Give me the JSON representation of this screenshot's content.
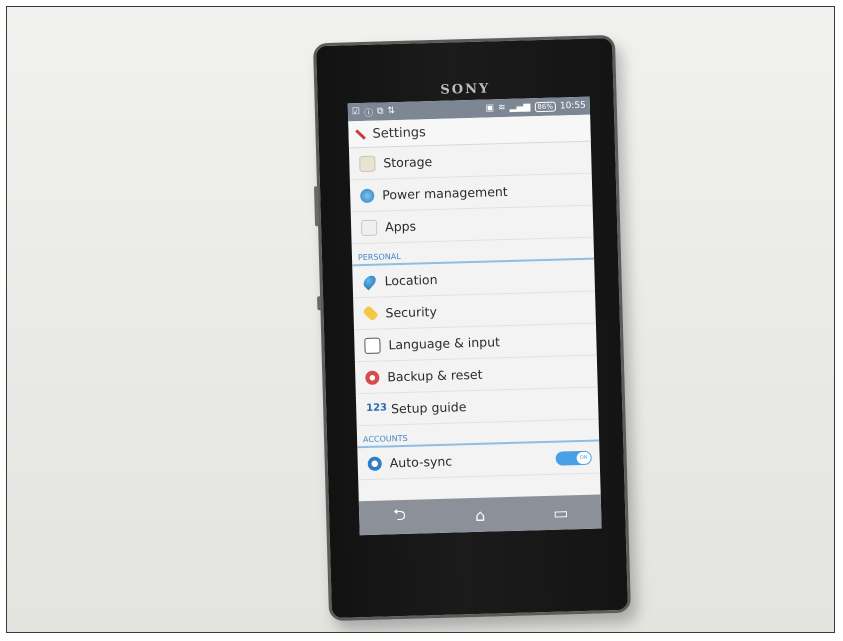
{
  "device": {
    "brand": "SONY"
  },
  "status_bar": {
    "battery": "86%",
    "time": "10:55"
  },
  "action_bar": {
    "title": "Settings"
  },
  "device_items": [
    {
      "label": "Storage",
      "icon": "storage-icon"
    },
    {
      "label": "Power management",
      "icon": "power-management-icon"
    },
    {
      "label": "Apps",
      "icon": "apps-icon"
    }
  ],
  "personal": {
    "header": "PERSONAL",
    "items": [
      {
        "label": "Location",
        "icon": "location-icon"
      },
      {
        "label": "Security",
        "icon": "security-icon"
      },
      {
        "label": "Language & input",
        "icon": "keyboard-icon"
      },
      {
        "label": "Backup & reset",
        "icon": "backup-reset-icon"
      },
      {
        "label": "Setup guide",
        "icon": "setup-guide-icon",
        "glyph": "123"
      }
    ]
  },
  "accounts": {
    "header": "ACCOUNTS",
    "auto_sync": {
      "label": "Auto-sync",
      "toggle_text": "ON"
    }
  },
  "nav": {
    "back": "⮌",
    "home": "⌂",
    "recents": "▭"
  },
  "colors": {
    "accent": "#3f86c8",
    "status_bar": "#7d8794",
    "toggle_on": "#4aa0e6"
  }
}
